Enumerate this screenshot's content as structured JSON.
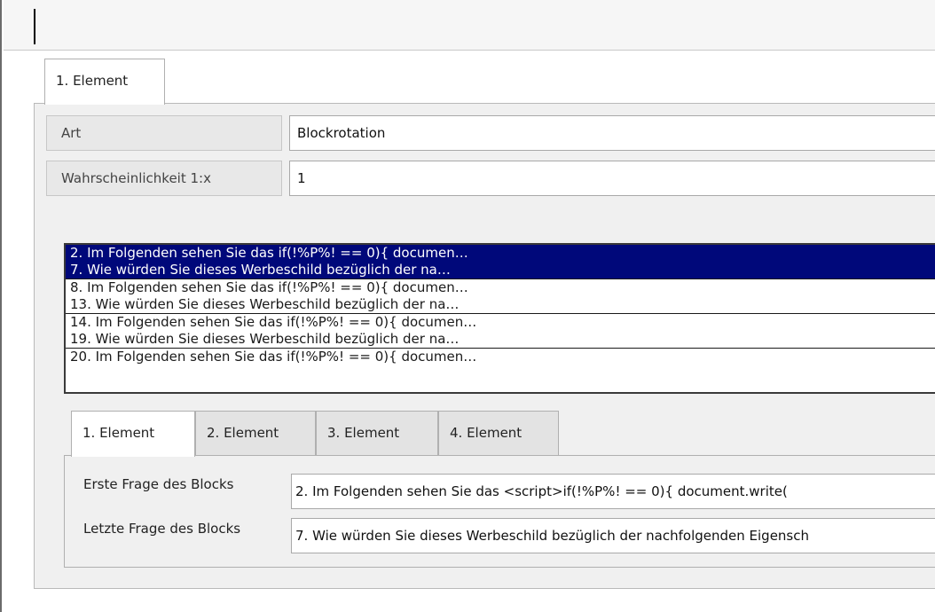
{
  "outer_tabs": [
    {
      "label": "1. Element"
    }
  ],
  "fields": {
    "art": {
      "label": "Art",
      "value": "Blockrotation"
    },
    "wahrscheinlichkeit": {
      "label": "Wahrscheinlichkeit 1:x",
      "value": "1"
    }
  },
  "question_list": {
    "groups": [
      {
        "lines": [
          "2. Im Folgenden sehen Sie das if(!%P%! == 0){ documen…",
          "7. Wie würden Sie dieses Werbeschild bezüglich der na…"
        ],
        "selected": true
      },
      {
        "lines": [
          "8. Im Folgenden sehen Sie das if(!%P%! == 0){ documen…",
          "13. Wie würden Sie dieses Werbeschild bezüglich der na…"
        ],
        "selected": false
      },
      {
        "lines": [
          "14. Im Folgenden sehen Sie das if(!%P%! == 0){ documen…",
          "19. Wie würden Sie dieses Werbeschild bezüglich der na…"
        ],
        "selected": false
      },
      {
        "lines": [
          "20. Im Folgenden sehen Sie das if(!%P%! == 0){ documen…"
        ],
        "selected": false
      }
    ]
  },
  "inner_tabs": [
    {
      "label": "1. Element"
    },
    {
      "label": "2. Element"
    },
    {
      "label": "3. Element"
    },
    {
      "label": "4. Element"
    }
  ],
  "block": {
    "first_label": "Erste Frage des Blocks",
    "first_value": "2. Im Folgenden sehen Sie das <script>if(!%P%! == 0){  document.write(",
    "last_label": "Letzte Frage des Blocks",
    "last_value": "7. Wie würden Sie dieses Werbeschild bezüglich der nachfolgenden Eigensch"
  }
}
